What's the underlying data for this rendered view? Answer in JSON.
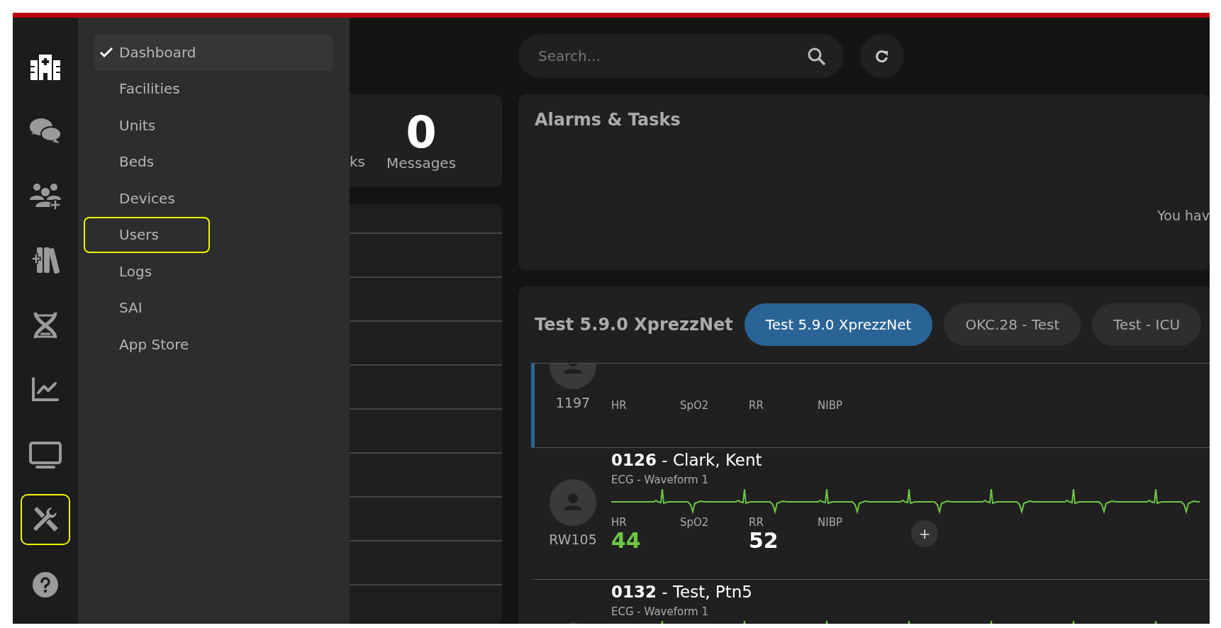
{
  "rail": [
    {
      "kind": "hospital",
      "active": true,
      "highlighted": false
    },
    {
      "kind": "chat",
      "active": false,
      "highlighted": false
    },
    {
      "kind": "users",
      "active": false,
      "highlighted": false
    },
    {
      "kind": "library",
      "active": false,
      "highlighted": false
    },
    {
      "kind": "dna",
      "active": false,
      "highlighted": false
    },
    {
      "kind": "chart",
      "active": false,
      "highlighted": false
    },
    {
      "kind": "monitor",
      "active": false,
      "highlighted": false
    },
    {
      "kind": "tools",
      "active": false,
      "highlighted": true
    },
    {
      "kind": "help",
      "active": false,
      "highlighted": false
    }
  ],
  "menu": [
    {
      "label": "Dashboard",
      "selected": true,
      "highlighted": false
    },
    {
      "label": "Facilities",
      "selected": false,
      "highlighted": false
    },
    {
      "label": "Units",
      "selected": false,
      "highlighted": false
    },
    {
      "label": "Beds",
      "selected": false,
      "highlighted": false
    },
    {
      "label": "Devices",
      "selected": false,
      "highlighted": false
    },
    {
      "label": "Users",
      "selected": false,
      "highlighted": true
    },
    {
      "label": "Logs",
      "selected": false,
      "highlighted": false
    },
    {
      "label": "SAI",
      "selected": false,
      "highlighted": false
    },
    {
      "label": "App Store",
      "selected": false,
      "highlighted": false
    }
  ],
  "search": {
    "placeholder": "Search..."
  },
  "stats": {
    "cut_label": "ks",
    "items": [
      {
        "value": "0",
        "label": "Messages"
      }
    ]
  },
  "alarms": {
    "title": "Alarms & Tasks",
    "message": "You hav"
  },
  "units": {
    "title": "Test 5.9.0 XprezzNet",
    "tabs": [
      {
        "label": "Test 5.9.0 XprezzNet",
        "selected": true
      },
      {
        "label": "OKC.28 - Test",
        "selected": false
      },
      {
        "label": "Test - ICU",
        "selected": false
      }
    ]
  },
  "patients": [
    {
      "bed": "1197",
      "selected": true,
      "vitals": [
        {
          "label": "HR"
        },
        {
          "label": "SpO2"
        },
        {
          "label": "RR"
        },
        {
          "label": "NIBP"
        }
      ]
    },
    {
      "bed": "RW105",
      "selected": false,
      "title": "**0126** - Clark, Kent",
      "waveform": "ECG - Waveform 1",
      "add": "+",
      "vitals": [
        {
          "label": "HR",
          "value": "44",
          "color": "#6cc644"
        },
        {
          "label": "SpO2"
        },
        {
          "label": "RR",
          "value": "52",
          "color": "#ffffff"
        },
        {
          "label": "NIBP"
        }
      ]
    },
    {
      "selected": false,
      "title": "**0132** - Test, Ptn5",
      "waveform": "ECG - Waveform 1"
    }
  ]
}
